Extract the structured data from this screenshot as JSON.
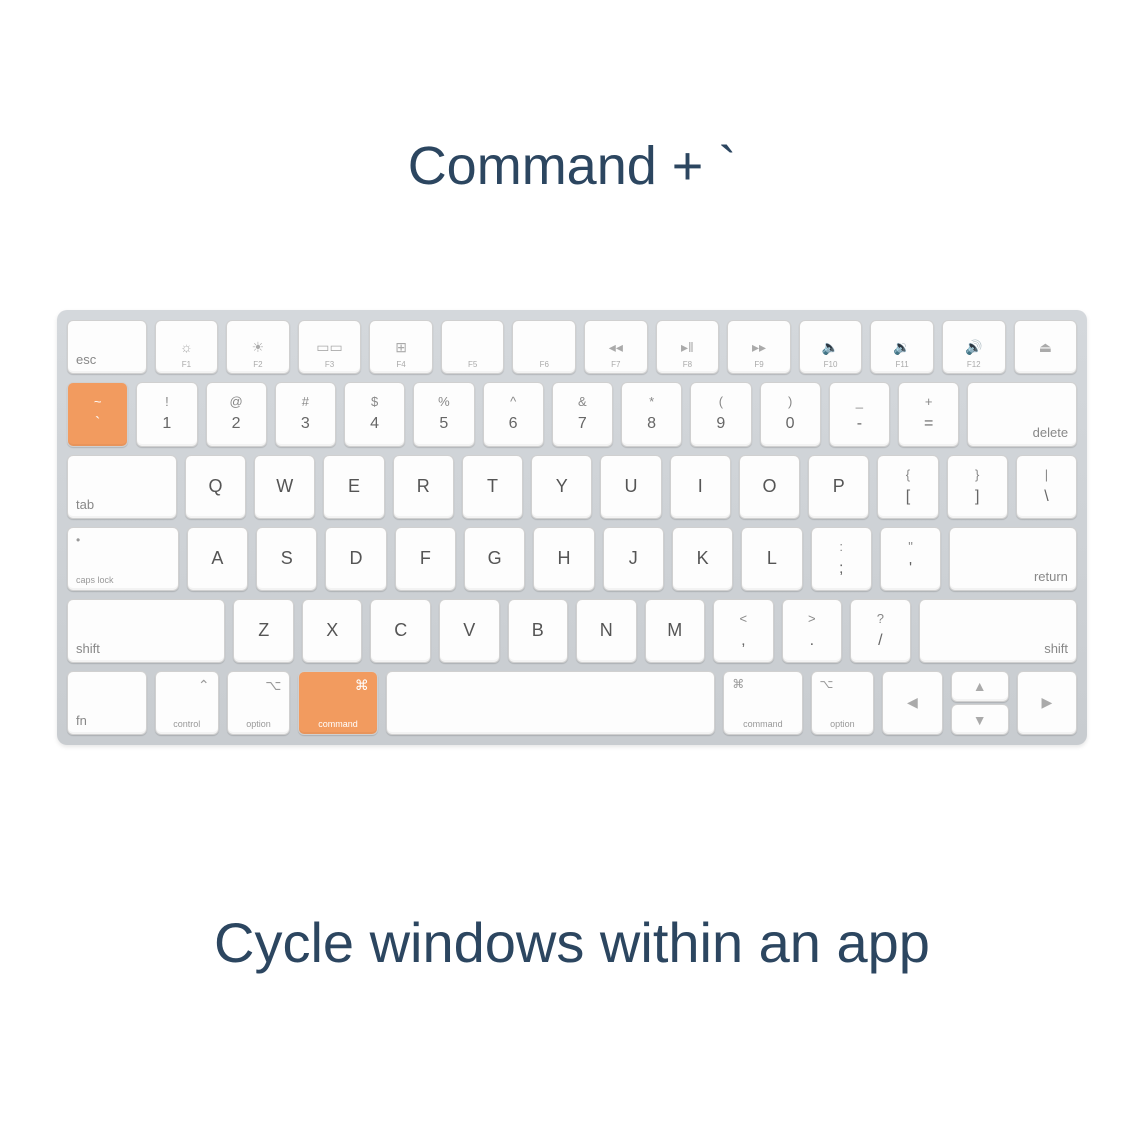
{
  "title": "Command + `",
  "description": "Cycle windows within an app",
  "colors": {
    "highlight": "#f29b5f",
    "text": "#2c4660"
  },
  "highlighted_keys": [
    "backtick",
    "command-left"
  ],
  "keyboard": {
    "row_fn": {
      "esc": "esc",
      "keys": [
        {
          "label": "F1",
          "icon": "brightness-down"
        },
        {
          "label": "F2",
          "icon": "brightness-up"
        },
        {
          "label": "F3",
          "icon": "mission-control"
        },
        {
          "label": "F4",
          "icon": "launchpad"
        },
        {
          "label": "F5",
          "icon": ""
        },
        {
          "label": "F6",
          "icon": ""
        },
        {
          "label": "F7",
          "icon": "rewind"
        },
        {
          "label": "F8",
          "icon": "play-pause"
        },
        {
          "label": "F9",
          "icon": "fast-forward"
        },
        {
          "label": "F10",
          "icon": "mute"
        },
        {
          "label": "F11",
          "icon": "volume-down"
        },
        {
          "label": "F12",
          "icon": "volume-up"
        }
      ],
      "eject": "eject"
    },
    "row_num": {
      "backtick": {
        "top": "~",
        "bottom": "`"
      },
      "keys": [
        {
          "top": "!",
          "bottom": "1"
        },
        {
          "top": "@",
          "bottom": "2"
        },
        {
          "top": "#",
          "bottom": "3"
        },
        {
          "top": "$",
          "bottom": "4"
        },
        {
          "top": "%",
          "bottom": "5"
        },
        {
          "top": "^",
          "bottom": "6"
        },
        {
          "top": "&",
          "bottom": "7"
        },
        {
          "top": "*",
          "bottom": "8"
        },
        {
          "top": "(",
          "bottom": "9"
        },
        {
          "top": ")",
          "bottom": "0"
        },
        {
          "top": "_",
          "bottom": "-"
        },
        {
          "top": "+",
          "bottom": "="
        }
      ],
      "delete": "delete"
    },
    "row_qwerty": {
      "tab": "tab",
      "keys": [
        "Q",
        "W",
        "E",
        "R",
        "T",
        "Y",
        "U",
        "I",
        "O",
        "P"
      ],
      "brackets": [
        {
          "top": "{",
          "bottom": "["
        },
        {
          "top": "}",
          "bottom": "]"
        },
        {
          "top": "|",
          "bottom": "\\"
        }
      ]
    },
    "row_asdf": {
      "caps": {
        "symbol": "•",
        "label": "caps lock"
      },
      "keys": [
        "A",
        "S",
        "D",
        "F",
        "G",
        "H",
        "J",
        "K",
        "L"
      ],
      "punct": [
        {
          "top": ":",
          "bottom": ";"
        },
        {
          "top": "\"",
          "bottom": "'"
        }
      ],
      "return": "return"
    },
    "row_zxcv": {
      "shift_l": "shift",
      "keys": [
        "Z",
        "X",
        "C",
        "V",
        "B",
        "N",
        "M"
      ],
      "punct": [
        {
          "top": "<",
          "bottom": ","
        },
        {
          "top": ">",
          "bottom": "."
        },
        {
          "top": "?",
          "bottom": "/"
        }
      ],
      "shift_r": "shift"
    },
    "row_bottom": {
      "fn": "fn",
      "control": {
        "symbol": "⌃",
        "label": "control"
      },
      "option_l": {
        "symbol": "⌥",
        "label": "option"
      },
      "command_l": {
        "symbol": "⌘",
        "label": "command"
      },
      "space": "",
      "command_r": {
        "symbol": "⌘",
        "label": "command"
      },
      "option_r": {
        "symbol": "⌥",
        "label": "option"
      },
      "arrows": {
        "left": "◀",
        "up": "▲",
        "down": "▼",
        "right": "▶"
      }
    }
  }
}
